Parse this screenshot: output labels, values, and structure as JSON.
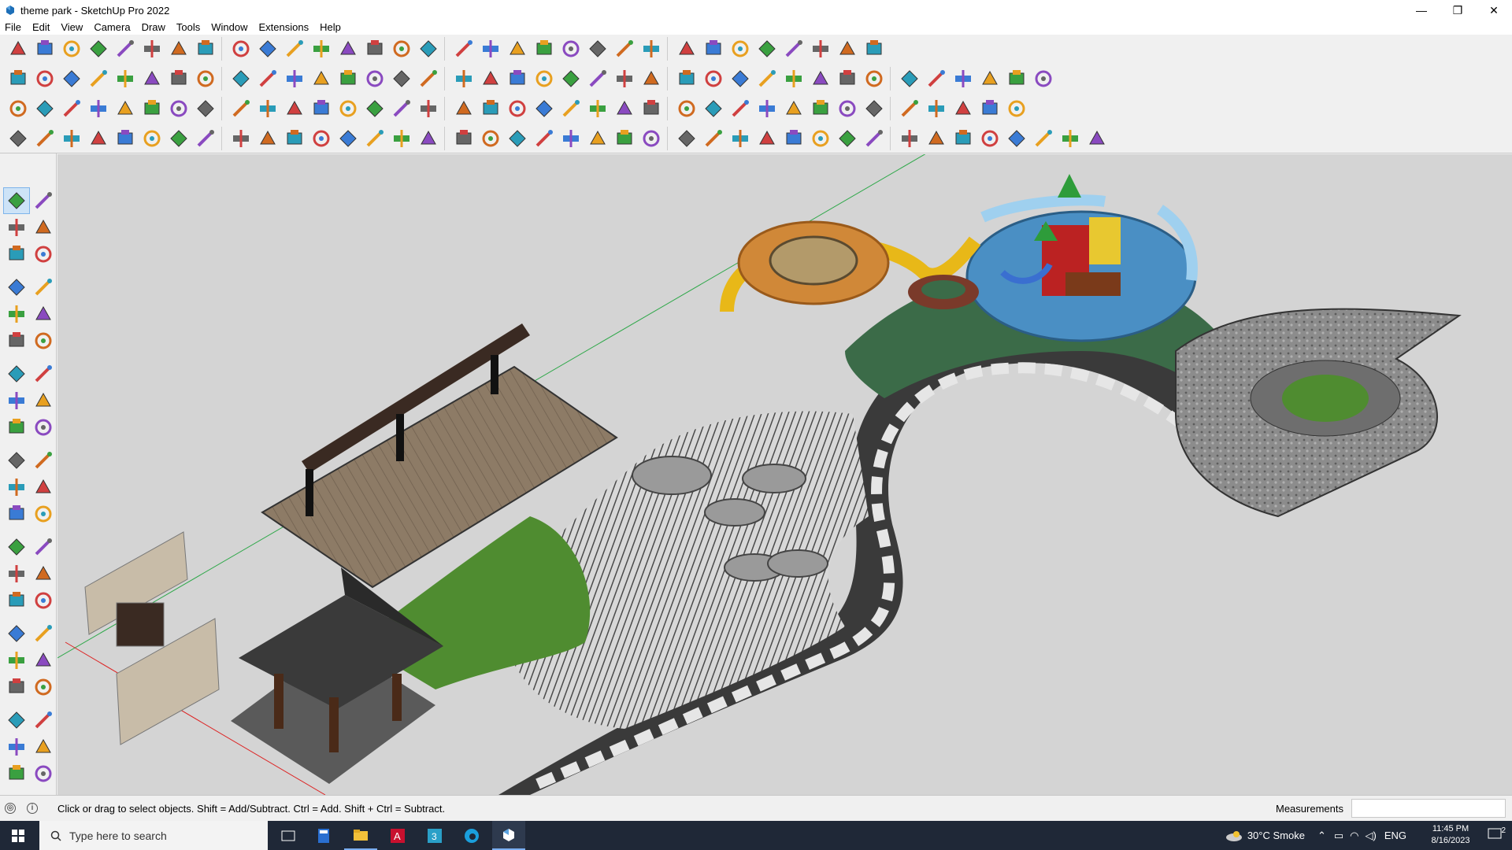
{
  "window": {
    "title": "theme park - SketchUp Pro 2022",
    "minimize": "—",
    "restore": "❐",
    "close": "✕"
  },
  "menu": [
    "File",
    "Edit",
    "View",
    "Camera",
    "Draw",
    "Tools",
    "Window",
    "Extensions",
    "Help"
  ],
  "status": {
    "hint": "Click or drag to select objects. Shift = Add/Subtract. Ctrl = Add. Shift + Ctrl = Subtract.",
    "measurements_label": "Measurements",
    "measurements_value": ""
  },
  "taskbar": {
    "search_placeholder": "Type here to search",
    "weather": "30°C  Smoke",
    "language": "ENG",
    "time": "11:45 PM",
    "date": "8/16/2023",
    "notification_count": "2"
  },
  "colors": {
    "ground": "#d4d4d4",
    "pool": "#4a8fc4",
    "turf": "#3b6b48",
    "stone": "#3a3a3a",
    "paver": "#e6e6e6",
    "lawn": "#4f8c30",
    "yellow": "#e8b818",
    "wood": "#8b7358"
  }
}
